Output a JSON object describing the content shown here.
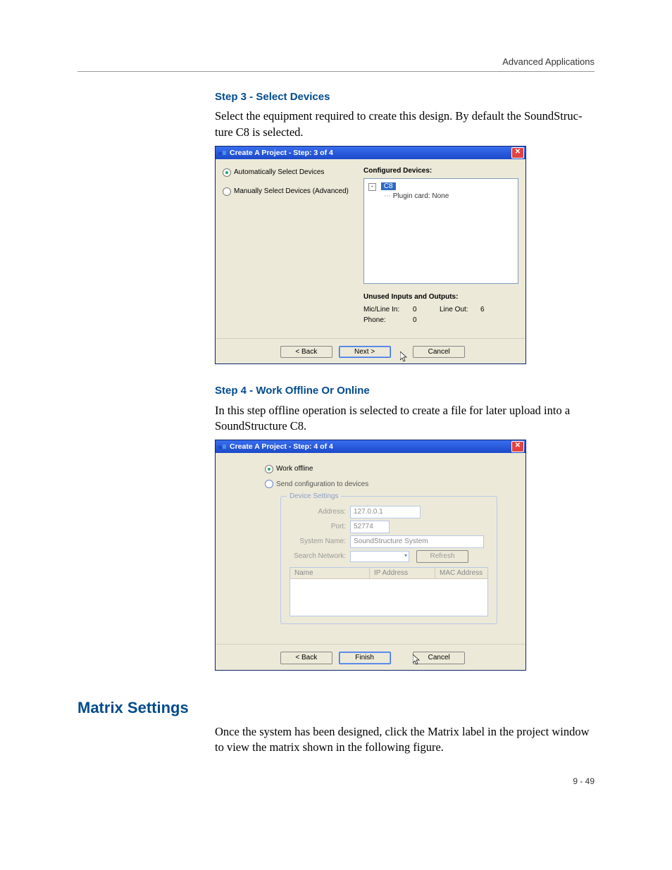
{
  "header": {
    "running_title": "Advanced Applications"
  },
  "step3": {
    "heading": "Step 3 - Select Devices",
    "paragraph": "Select the equipment required to create this design. By default the SoundStruc­ture C8 is selected.",
    "dialog": {
      "title": "Create A Project - Step: 3 of 4",
      "radio_auto": "Automatically Select Devices",
      "radio_manual": "Manually Select Devices (Advanced)",
      "configured_label": "Configured Devices:",
      "tree_root": "C8",
      "tree_child": "Plugin card: None",
      "unused_label": "Unused Inputs and Outputs:",
      "mic_label": "Mic/Line In:",
      "mic_val": "0",
      "lineout_label": "Line Out:",
      "lineout_val": "6",
      "phone_label": "Phone:",
      "phone_val": "0",
      "back": "< Back",
      "next": "Next >",
      "cancel": "Cancel"
    }
  },
  "step4": {
    "heading": "Step 4 - Work Offline Or Online",
    "paragraph": "In this step offline operation is selected to create a file for later upload into a SoundStructure C8.",
    "dialog": {
      "title": "Create A Project - Step: 4 of 4",
      "radio_offline": "Work offline",
      "radio_send": "Send configuration to devices",
      "legend": "Device Settings",
      "address_lbl": "Address:",
      "address_val": "127.0.0.1",
      "port_lbl": "Port:",
      "port_val": "52774",
      "sysname_lbl": "System Name:",
      "sysname_val": "SoundStructure System",
      "search_lbl": "Search Network:",
      "refresh": "Refresh",
      "col_name": "Name",
      "col_ip": "IP Address",
      "col_mac": "MAC Address",
      "back": "< Back",
      "finish": "Finish",
      "cancel": "Cancel"
    }
  },
  "matrix": {
    "heading": "Matrix Settings",
    "paragraph": "Once the system has been designed, click the Matrix label in the project window to view the matrix shown in the following figure."
  },
  "footer": {
    "page": "9 - 49"
  }
}
